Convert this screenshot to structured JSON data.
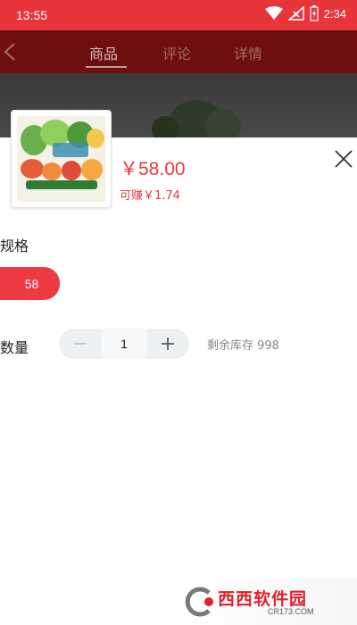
{
  "status_bar": {
    "time": "13:55",
    "clock_right": "2:34",
    "icons": [
      "wifi-icon",
      "signal-icon",
      "battery-icon"
    ]
  },
  "header": {
    "tabs": [
      {
        "label": "商品",
        "active": true
      },
      {
        "label": "评论",
        "active": false
      },
      {
        "label": "详情",
        "active": false
      }
    ]
  },
  "product": {
    "price": "￥58.00",
    "earn": "可赚￥1.74"
  },
  "spec": {
    "label": "规格",
    "selected": "58"
  },
  "quantity": {
    "label": "数量",
    "value": "1",
    "stock": "剩余库存 998"
  },
  "watermark": {
    "name": "西西软件园",
    "url": "CR173.COM"
  },
  "colors": {
    "accent": "#e8343b",
    "price": "#e5393f"
  }
}
